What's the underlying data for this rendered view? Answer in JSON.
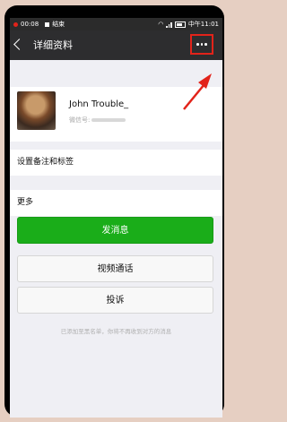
{
  "status_bar": {
    "time": "00:08",
    "recording_label": "结束",
    "carrier_time": "中午11:01"
  },
  "header": {
    "title": "详细资料"
  },
  "profile": {
    "name": "John Trouble_",
    "wechat_id_label": "微信号:"
  },
  "menu": {
    "remark_tags": "设置备注和标签",
    "more": "更多"
  },
  "buttons": {
    "send_message": "发消息",
    "video_call": "视频通话",
    "report": "投诉"
  },
  "hint": "已添加至黑名单，你将不再收到对方的消息",
  "colors": {
    "accent_red": "#e2231a",
    "primary_green": "#1aad19",
    "title_bar": "#2d2d2f"
  }
}
